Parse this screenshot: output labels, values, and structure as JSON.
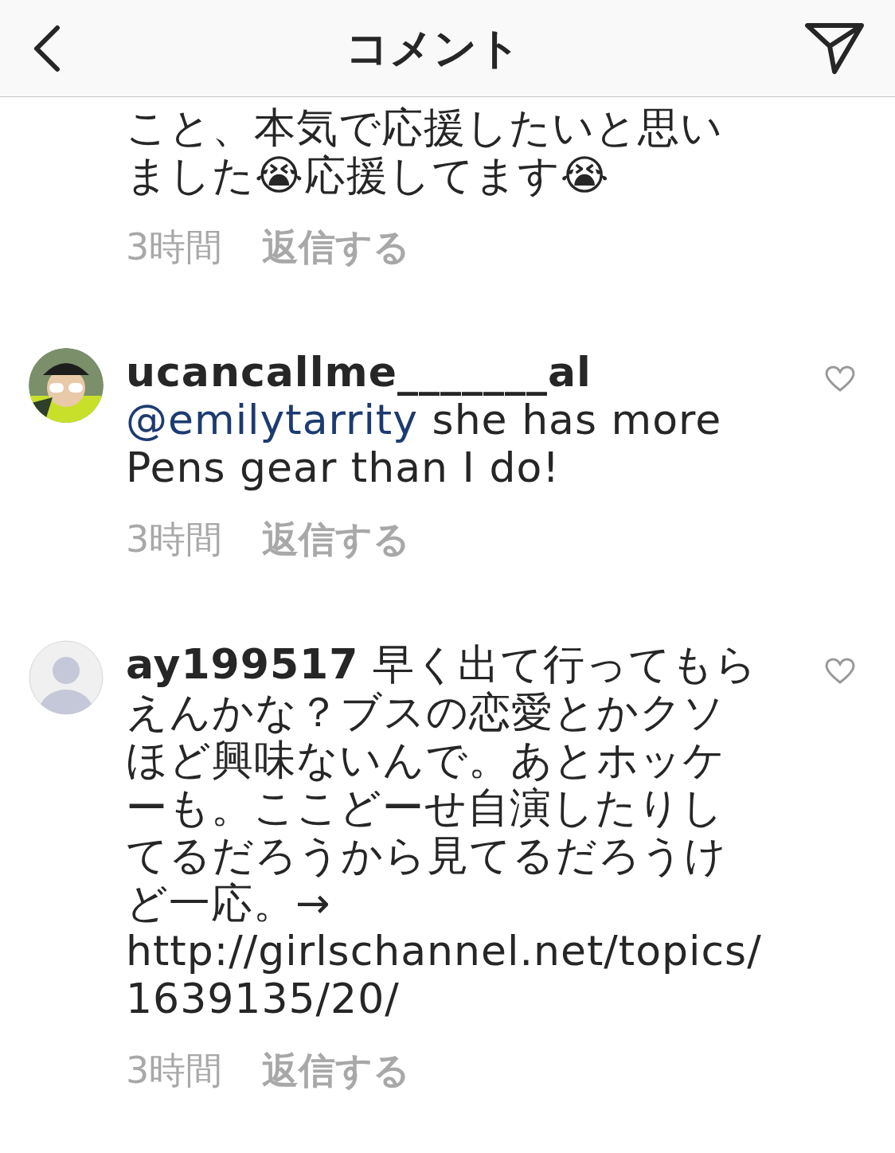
{
  "header": {
    "title": "コメント"
  },
  "comments": [
    {
      "text": "こと、本気で応援したいと思いました😭応援してます😭",
      "time": "3時間",
      "reply": "返信する"
    },
    {
      "username": "ucancallme_______al",
      "mention": "@emilytarrity",
      "text": " she has more Pens gear than I do!",
      "time": "3時間",
      "reply": "返信する",
      "liked": false
    },
    {
      "avatar": {
        "kind": "default"
      },
      "username": "ay199517",
      "text": " 早く出て行ってもらえんかな？ブスの恋愛とかクソほど興味ないんで。あとホッケーも。ここどーせ自演したりしてるだろうから見てるだろうけど一応。→ http://girlschannel.net/topics/1639135/20/",
      "time": "3時間",
      "reply": "返信する",
      "liked": false
    }
  ]
}
